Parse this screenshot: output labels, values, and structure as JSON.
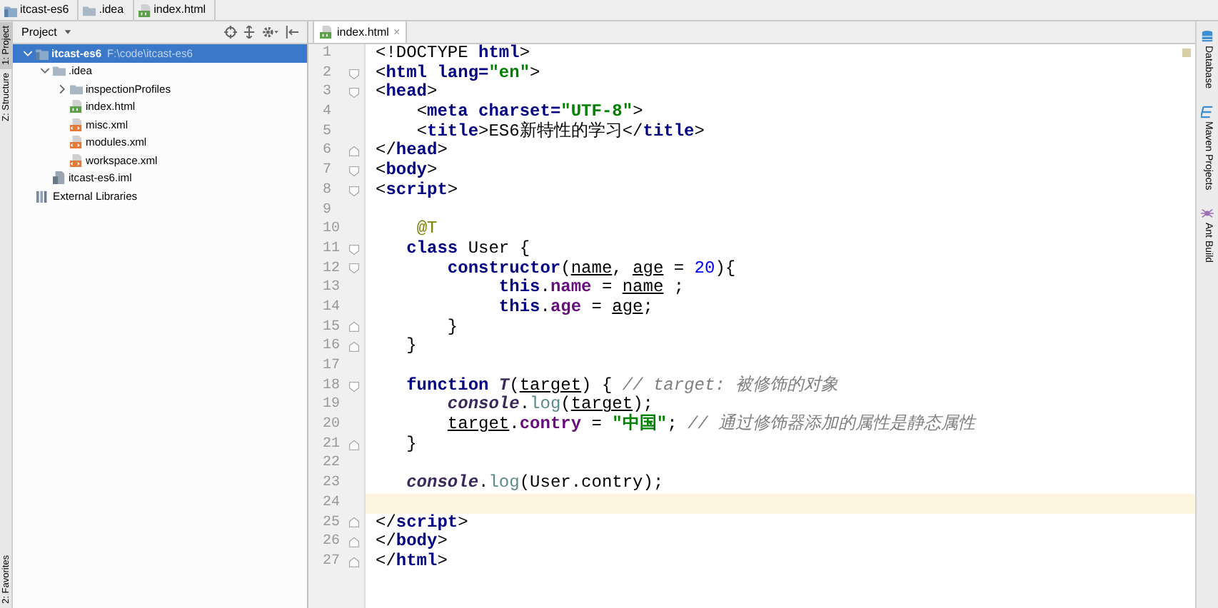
{
  "breadcrumbs": [
    {
      "label": "itcast-es6",
      "kind": "project"
    },
    {
      "label": ".idea",
      "kind": "folder"
    },
    {
      "label": "index.html",
      "kind": "html"
    }
  ],
  "left_stripe": [
    {
      "label": "1: Project",
      "selected": true
    },
    {
      "label": "Z: Structure",
      "selected": false
    }
  ],
  "left_stripe_bottom": [
    {
      "label": "2: Favorites",
      "selected": false
    }
  ],
  "project_panel": {
    "title": "Project",
    "tree": [
      {
        "label": "itcast-es6",
        "path": "F:\\code\\itcast-es6",
        "kind": "project",
        "expanded": true,
        "selected": true,
        "children": [
          {
            "label": ".idea",
            "kind": "folder",
            "expanded": true,
            "selected": false,
            "children": [
              {
                "label": "inspectionProfiles",
                "kind": "folder",
                "expanded": false,
                "selected": false
              },
              {
                "label": "index.html",
                "kind": "html",
                "selected": false
              },
              {
                "label": "misc.xml",
                "kind": "xml",
                "selected": false
              },
              {
                "label": "modules.xml",
                "kind": "xml",
                "selected": false
              },
              {
                "label": "workspace.xml",
                "kind": "xml",
                "selected": false
              }
            ]
          },
          {
            "label": "itcast-es6.iml",
            "kind": "iml",
            "selected": false
          }
        ]
      },
      {
        "label": "External Libraries",
        "kind": "library",
        "selected": false
      }
    ]
  },
  "editor": {
    "tabs": [
      {
        "label": "index.html",
        "kind": "html",
        "selected": true,
        "close": "×"
      }
    ],
    "lines": [
      {
        "number": "1",
        "kind": "plain",
        "tokens": [
          {
            "text": "<!DOCTYPE ",
            "kind": "punct"
          },
          {
            "text": "html",
            "kind": "tag"
          },
          {
            "text": ">",
            "kind": "punct"
          }
        ]
      },
      {
        "number": "2",
        "kind": "fold-start",
        "tokens": [
          {
            "text": "<",
            "kind": "punct"
          },
          {
            "text": "html ",
            "kind": "tag"
          },
          {
            "text": "lang=",
            "kind": "tag"
          },
          {
            "text": "\"en\"",
            "kind": "str"
          },
          {
            "text": ">",
            "kind": "punct"
          }
        ]
      },
      {
        "number": "3",
        "kind": "fold-start",
        "tokens": [
          {
            "text": "<",
            "kind": "punct"
          },
          {
            "text": "head",
            "kind": "tag"
          },
          {
            "text": ">",
            "kind": "punct"
          }
        ]
      },
      {
        "number": "4",
        "kind": "plain",
        "tokens": [
          {
            "text": "    <",
            "kind": "punct"
          },
          {
            "text": "meta ",
            "kind": "tag"
          },
          {
            "text": "charset=",
            "kind": "tag"
          },
          {
            "text": "\"UTF-8\"",
            "kind": "str"
          },
          {
            "text": ">",
            "kind": "punct"
          }
        ]
      },
      {
        "number": "5",
        "kind": "plain",
        "tokens": [
          {
            "text": "    <",
            "kind": "punct"
          },
          {
            "text": "title",
            "kind": "tag"
          },
          {
            "text": ">ES6新特性的学习</",
            "kind": "punct"
          },
          {
            "text": "title",
            "kind": "tag"
          },
          {
            "text": ">",
            "kind": "punct"
          }
        ]
      },
      {
        "number": "6",
        "kind": "fold-end",
        "tokens": [
          {
            "text": "</",
            "kind": "punct"
          },
          {
            "text": "head",
            "kind": "tag"
          },
          {
            "text": ">",
            "kind": "punct"
          }
        ]
      },
      {
        "number": "7",
        "kind": "fold-start",
        "tokens": [
          {
            "text": "<",
            "kind": "punct"
          },
          {
            "text": "body",
            "kind": "tag"
          },
          {
            "text": ">",
            "kind": "punct"
          }
        ]
      },
      {
        "number": "8",
        "kind": "fold-start",
        "tokens": [
          {
            "text": "<",
            "kind": "punct"
          },
          {
            "text": "script",
            "kind": "tag"
          },
          {
            "text": ">",
            "kind": "punct"
          }
        ]
      },
      {
        "number": "9",
        "kind": "plain"
      },
      {
        "number": "10",
        "kind": "plain",
        "tokens": [
          {
            "text": "    @T",
            "kind": "ann"
          }
        ]
      },
      {
        "number": "11",
        "kind": "fold-start",
        "tokens": [
          {
            "text": "   class ",
            "kind": "kw"
          },
          {
            "text": "User {",
            "kind": "punct"
          }
        ]
      },
      {
        "number": "12",
        "kind": "fold-start",
        "tokens": [
          {
            "text": "       constructor",
            "kind": "kw"
          },
          {
            "text": "(",
            "kind": "punct"
          },
          {
            "text": "name",
            "kind": "param"
          },
          {
            "text": ", ",
            "kind": "punct"
          },
          {
            "text": "age",
            "kind": "param"
          },
          {
            "text": " = ",
            "kind": "punct"
          },
          {
            "text": "20",
            "kind": "num"
          },
          {
            "text": "){",
            "kind": "punct"
          }
        ]
      },
      {
        "number": "13",
        "kind": "plain",
        "tokens": [
          {
            "text": "            this",
            "kind": "kw"
          },
          {
            "text": ".",
            "kind": "punct"
          },
          {
            "text": "name",
            "kind": "field"
          },
          {
            "text": " = ",
            "kind": "punct"
          },
          {
            "text": "name",
            "kind": "param"
          },
          {
            "text": " ;",
            "kind": "punct"
          }
        ]
      },
      {
        "number": "14",
        "kind": "plain",
        "tokens": [
          {
            "text": "            this",
            "kind": "kw"
          },
          {
            "text": ".",
            "kind": "punct"
          },
          {
            "text": "age",
            "kind": "field"
          },
          {
            "text": " = ",
            "kind": "punct"
          },
          {
            "text": "age",
            "kind": "param"
          },
          {
            "text": ";",
            "kind": "punct"
          }
        ]
      },
      {
        "number": "15",
        "kind": "fold-end",
        "tokens": [
          {
            "text": "       }",
            "kind": "punct"
          }
        ]
      },
      {
        "number": "16",
        "kind": "fold-end",
        "tokens": [
          {
            "text": "   }",
            "kind": "punct"
          }
        ]
      },
      {
        "number": "17",
        "kind": "plain"
      },
      {
        "number": "18",
        "kind": "fold-start",
        "tokens": [
          {
            "text": "   function ",
            "kind": "kw"
          },
          {
            "text": "T",
            "kind": "italic"
          },
          {
            "text": "(",
            "kind": "punct"
          },
          {
            "text": "target",
            "kind": "param"
          },
          {
            "text": ") { ",
            "kind": "punct"
          },
          {
            "text": "// target: 被修饰的对象",
            "kind": "comment"
          }
        ]
      },
      {
        "number": "19",
        "kind": "plain",
        "tokens": [
          {
            "text": "       console",
            "kind": "italic"
          },
          {
            "text": ".",
            "kind": "punct"
          },
          {
            "text": "log",
            "kind": "call"
          },
          {
            "text": "(",
            "kind": "punct"
          },
          {
            "text": "target",
            "kind": "param"
          },
          {
            "text": ");",
            "kind": "punct"
          }
        ]
      },
      {
        "number": "20",
        "kind": "plain",
        "tokens": [
          {
            "text": "       target",
            "kind": "param"
          },
          {
            "text": ".",
            "kind": "punct"
          },
          {
            "text": "contry",
            "kind": "field"
          },
          {
            "text": " = ",
            "kind": "punct"
          },
          {
            "text": "\"中国\"",
            "kind": "str"
          },
          {
            "text": "; ",
            "kind": "punct"
          },
          {
            "text": "// 通过修饰器添加的属性是静态属性",
            "kind": "comment"
          }
        ]
      },
      {
        "number": "21",
        "kind": "fold-end",
        "tokens": [
          {
            "text": "   }",
            "kind": "punct"
          }
        ]
      },
      {
        "number": "22",
        "kind": "plain"
      },
      {
        "number": "23",
        "kind": "plain",
        "tokens": [
          {
            "text": "   console",
            "kind": "italic"
          },
          {
            "text": ".",
            "kind": "punct"
          },
          {
            "text": "log",
            "kind": "call"
          },
          {
            "text": "(User.contry);",
            "kind": "punct"
          }
        ]
      },
      {
        "number": "24",
        "kind": "plain",
        "current": true
      },
      {
        "number": "25",
        "kind": "fold-end",
        "tokens": [
          {
            "text": "</",
            "kind": "punct"
          },
          {
            "text": "script",
            "kind": "tag"
          },
          {
            "text": ">",
            "kind": "punct"
          }
        ]
      },
      {
        "number": "26",
        "kind": "fold-end",
        "tokens": [
          {
            "text": "</",
            "kind": "punct"
          },
          {
            "text": "body",
            "kind": "tag"
          },
          {
            "text": ">",
            "kind": "punct"
          }
        ]
      },
      {
        "number": "27",
        "kind": "fold-end",
        "tokens": [
          {
            "text": "</",
            "kind": "punct"
          },
          {
            "text": "html",
            "kind": "tag"
          },
          {
            "text": ">",
            "kind": "punct"
          }
        ]
      }
    ]
  },
  "right_stripe": [
    {
      "label": "Database",
      "kind": "database"
    },
    {
      "label": "Maven Projects",
      "kind": "maven"
    },
    {
      "label": "Ant Build",
      "kind": "ant"
    }
  ]
}
